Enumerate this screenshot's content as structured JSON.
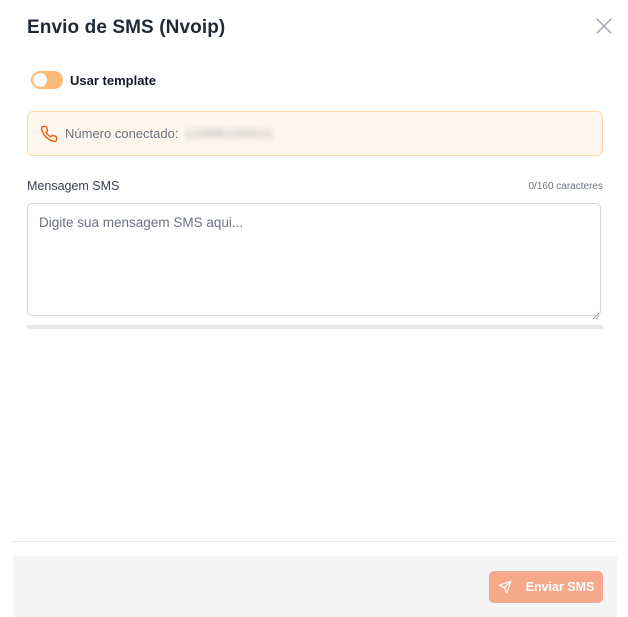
{
  "modal": {
    "title": "Envio de SMS (Nvoip)",
    "close_icon": "close-icon"
  },
  "template_toggle": {
    "label": "Usar template",
    "state": "off",
    "color": "#fdba74"
  },
  "connected_number": {
    "icon": "phone-icon",
    "label": "Número conectado:",
    "value": "12988106611",
    "value_blurred": true
  },
  "message": {
    "label": "Mensagem SMS",
    "counter": "0/160 caracteres",
    "placeholder": "Digite sua mensagem SMS aqui...",
    "value": ""
  },
  "footer": {
    "send_label": "Enviar SMS",
    "send_icon": "send-icon",
    "send_color": "#f5a98a"
  }
}
